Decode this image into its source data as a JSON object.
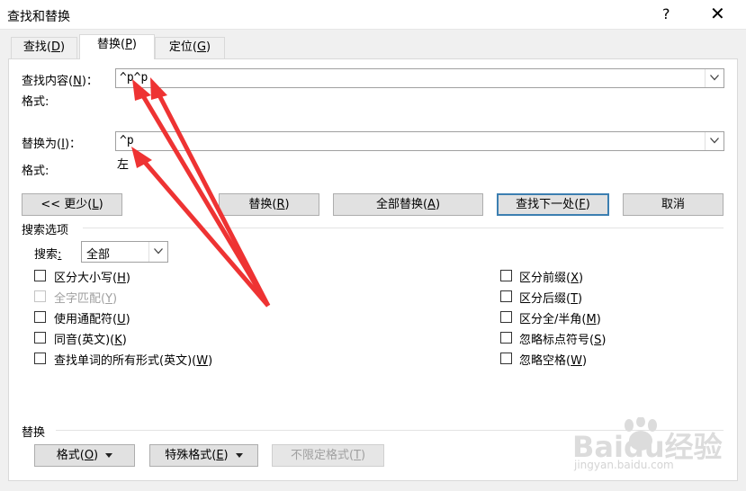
{
  "window": {
    "title": "查找和替换",
    "help_label": "?",
    "close_label": "✕"
  },
  "tabs": [
    {
      "label": "查找",
      "mnemonic": "D"
    },
    {
      "label": "替换",
      "mnemonic": "P"
    },
    {
      "label": "定位",
      "mnemonic": "G"
    }
  ],
  "find": {
    "label": "查找内容",
    "mnemonic": "N",
    "value": "^p^p",
    "format_label": "格式:"
  },
  "replace": {
    "label": "替换为",
    "mnemonic": "I",
    "value": "^p",
    "format_label": "格式:",
    "format_value": "左"
  },
  "buttons": {
    "less": {
      "text": "<< 更少",
      "mnemonic": "L"
    },
    "replace": {
      "text": "替换",
      "mnemonic": "R"
    },
    "replace_all": {
      "text": "全部替换",
      "mnemonic": "A"
    },
    "find_next": {
      "text": "查找下一处",
      "mnemonic": "F"
    },
    "cancel": {
      "text": "取消"
    }
  },
  "search_options": {
    "heading": "搜索选项",
    "search_label": "搜索",
    "search_mnemonic": ":",
    "search_value": "全部",
    "left": [
      {
        "label": "区分大小写",
        "mnemonic": "H",
        "checked": false,
        "disabled": false
      },
      {
        "label": "全字匹配",
        "mnemonic": "Y",
        "checked": false,
        "disabled": true
      },
      {
        "label": "使用通配符",
        "mnemonic": "U",
        "checked": false,
        "disabled": false
      },
      {
        "label": "同音(英文)",
        "mnemonic": "K",
        "checked": false,
        "disabled": false
      },
      {
        "label": "查找单词的所有形式(英文)",
        "mnemonic": "W",
        "checked": false,
        "disabled": false
      }
    ],
    "right": [
      {
        "label": "区分前缀",
        "mnemonic": "X",
        "checked": false,
        "disabled": false
      },
      {
        "label": "区分后缀",
        "mnemonic": "T",
        "checked": false,
        "disabled": false
      },
      {
        "label": "区分全/半角",
        "mnemonic": "M",
        "checked": false,
        "disabled": false
      },
      {
        "label": "忽略标点符号",
        "mnemonic": "S",
        "checked": false,
        "disabled": false
      },
      {
        "label": "忽略空格",
        "mnemonic": "W",
        "checked": false,
        "disabled": false
      }
    ]
  },
  "replace_section": {
    "heading": "替换",
    "format_button": {
      "text": "格式",
      "mnemonic": "O"
    },
    "special_button": {
      "text": "特殊格式",
      "mnemonic": "E"
    },
    "no_format_button": {
      "text": "不限定格式",
      "mnemonic": "T"
    }
  },
  "watermark": {
    "text": "Baidu经验",
    "subtext": "jingyan.baidu.com"
  },
  "colors": {
    "arrow": "#ee3333",
    "accent": "#3c7fb1"
  }
}
